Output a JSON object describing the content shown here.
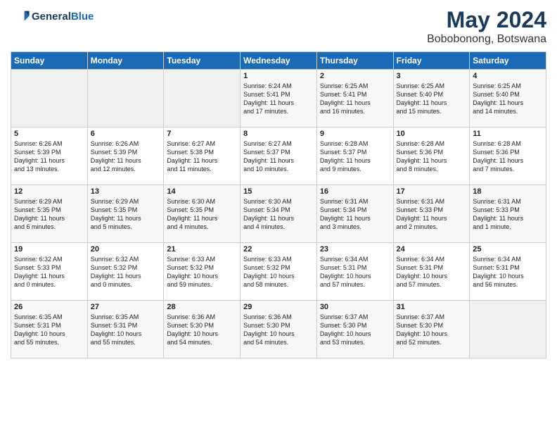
{
  "header": {
    "logo_line1": "General",
    "logo_line2": "Blue",
    "title": "May 2024",
    "subtitle": "Bobobonong, Botswana"
  },
  "weekdays": [
    "Sunday",
    "Monday",
    "Tuesday",
    "Wednesday",
    "Thursday",
    "Friday",
    "Saturday"
  ],
  "weeks": [
    [
      {
        "day": "",
        "info": ""
      },
      {
        "day": "",
        "info": ""
      },
      {
        "day": "",
        "info": ""
      },
      {
        "day": "1",
        "info": "Sunrise: 6:24 AM\nSunset: 5:41 PM\nDaylight: 11 hours\nand 17 minutes."
      },
      {
        "day": "2",
        "info": "Sunrise: 6:25 AM\nSunset: 5:41 PM\nDaylight: 11 hours\nand 16 minutes."
      },
      {
        "day": "3",
        "info": "Sunrise: 6:25 AM\nSunset: 5:40 PM\nDaylight: 11 hours\nand 15 minutes."
      },
      {
        "day": "4",
        "info": "Sunrise: 6:25 AM\nSunset: 5:40 PM\nDaylight: 11 hours\nand 14 minutes."
      }
    ],
    [
      {
        "day": "5",
        "info": "Sunrise: 6:26 AM\nSunset: 5:39 PM\nDaylight: 11 hours\nand 13 minutes."
      },
      {
        "day": "6",
        "info": "Sunrise: 6:26 AM\nSunset: 5:39 PM\nDaylight: 11 hours\nand 12 minutes."
      },
      {
        "day": "7",
        "info": "Sunrise: 6:27 AM\nSunset: 5:38 PM\nDaylight: 11 hours\nand 11 minutes."
      },
      {
        "day": "8",
        "info": "Sunrise: 6:27 AM\nSunset: 5:37 PM\nDaylight: 11 hours\nand 10 minutes."
      },
      {
        "day": "9",
        "info": "Sunrise: 6:28 AM\nSunset: 5:37 PM\nDaylight: 11 hours\nand 9 minutes."
      },
      {
        "day": "10",
        "info": "Sunrise: 6:28 AM\nSunset: 5:36 PM\nDaylight: 11 hours\nand 8 minutes."
      },
      {
        "day": "11",
        "info": "Sunrise: 6:28 AM\nSunset: 5:36 PM\nDaylight: 11 hours\nand 7 minutes."
      }
    ],
    [
      {
        "day": "12",
        "info": "Sunrise: 6:29 AM\nSunset: 5:35 PM\nDaylight: 11 hours\nand 6 minutes."
      },
      {
        "day": "13",
        "info": "Sunrise: 6:29 AM\nSunset: 5:35 PM\nDaylight: 11 hours\nand 5 minutes."
      },
      {
        "day": "14",
        "info": "Sunrise: 6:30 AM\nSunset: 5:35 PM\nDaylight: 11 hours\nand 4 minutes."
      },
      {
        "day": "15",
        "info": "Sunrise: 6:30 AM\nSunset: 5:34 PM\nDaylight: 11 hours\nand 4 minutes."
      },
      {
        "day": "16",
        "info": "Sunrise: 6:31 AM\nSunset: 5:34 PM\nDaylight: 11 hours\nand 3 minutes."
      },
      {
        "day": "17",
        "info": "Sunrise: 6:31 AM\nSunset: 5:33 PM\nDaylight: 11 hours\nand 2 minutes."
      },
      {
        "day": "18",
        "info": "Sunrise: 6:31 AM\nSunset: 5:33 PM\nDaylight: 11 hours\nand 1 minute."
      }
    ],
    [
      {
        "day": "19",
        "info": "Sunrise: 6:32 AM\nSunset: 5:33 PM\nDaylight: 11 hours\nand 0 minutes."
      },
      {
        "day": "20",
        "info": "Sunrise: 6:32 AM\nSunset: 5:32 PM\nDaylight: 11 hours\nand 0 minutes."
      },
      {
        "day": "21",
        "info": "Sunrise: 6:33 AM\nSunset: 5:32 PM\nDaylight: 10 hours\nand 59 minutes."
      },
      {
        "day": "22",
        "info": "Sunrise: 6:33 AM\nSunset: 5:32 PM\nDaylight: 10 hours\nand 58 minutes."
      },
      {
        "day": "23",
        "info": "Sunrise: 6:34 AM\nSunset: 5:31 PM\nDaylight: 10 hours\nand 57 minutes."
      },
      {
        "day": "24",
        "info": "Sunrise: 6:34 AM\nSunset: 5:31 PM\nDaylight: 10 hours\nand 57 minutes."
      },
      {
        "day": "25",
        "info": "Sunrise: 6:34 AM\nSunset: 5:31 PM\nDaylight: 10 hours\nand 56 minutes."
      }
    ],
    [
      {
        "day": "26",
        "info": "Sunrise: 6:35 AM\nSunset: 5:31 PM\nDaylight: 10 hours\nand 55 minutes."
      },
      {
        "day": "27",
        "info": "Sunrise: 6:35 AM\nSunset: 5:31 PM\nDaylight: 10 hours\nand 55 minutes."
      },
      {
        "day": "28",
        "info": "Sunrise: 6:36 AM\nSunset: 5:30 PM\nDaylight: 10 hours\nand 54 minutes."
      },
      {
        "day": "29",
        "info": "Sunrise: 6:36 AM\nSunset: 5:30 PM\nDaylight: 10 hours\nand 54 minutes."
      },
      {
        "day": "30",
        "info": "Sunrise: 6:37 AM\nSunset: 5:30 PM\nDaylight: 10 hours\nand 53 minutes."
      },
      {
        "day": "31",
        "info": "Sunrise: 6:37 AM\nSunset: 5:30 PM\nDaylight: 10 hours\nand 52 minutes."
      },
      {
        "day": "",
        "info": ""
      }
    ]
  ]
}
